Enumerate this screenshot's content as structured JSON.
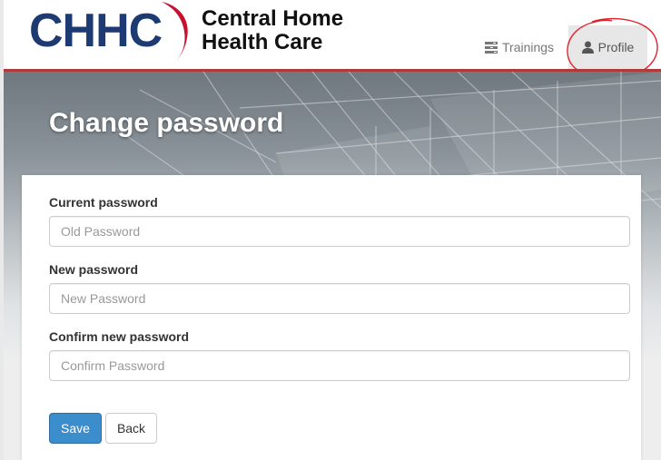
{
  "logo": {
    "text": "CHHC"
  },
  "brand": {
    "line1": "Central Home",
    "line2": "Health Care"
  },
  "nav": {
    "trainings": {
      "label": "Trainings",
      "icon": "tasks-icon"
    },
    "profile": {
      "label": "Profile",
      "icon": "user-icon"
    }
  },
  "page": {
    "title": "Change password"
  },
  "form": {
    "current": {
      "label": "Current password",
      "placeholder": "Old Password",
      "value": ""
    },
    "new": {
      "label": "New password",
      "placeholder": "New Password",
      "value": ""
    },
    "confirm": {
      "label": "Confirm new password",
      "placeholder": "Confirm Password",
      "value": ""
    },
    "save_label": "Save",
    "back_label": "Back"
  },
  "colors": {
    "brand_blue": "#1d3a73",
    "brand_red": "#c8102e",
    "header_rule": "#b03a3a",
    "primary_button": "#3c8dcb",
    "annotation": "#e0202a"
  }
}
